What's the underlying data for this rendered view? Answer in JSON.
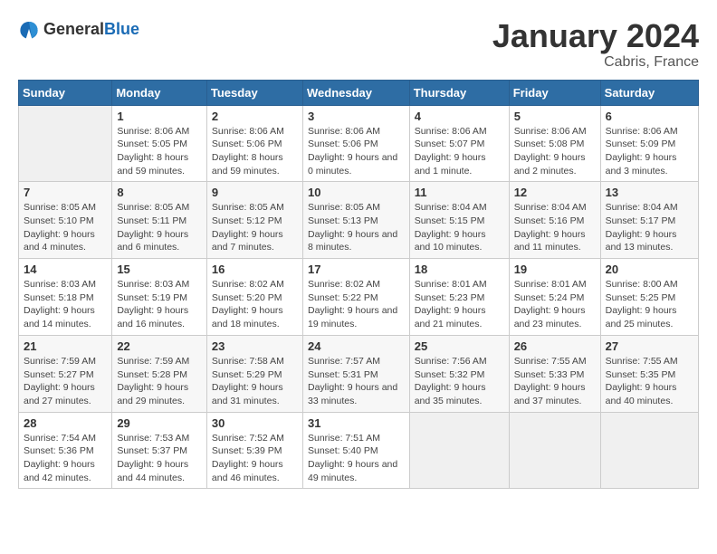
{
  "logo": {
    "text_general": "General",
    "text_blue": "Blue"
  },
  "title": "January 2024",
  "location": "Cabris, France",
  "days_of_week": [
    "Sunday",
    "Monday",
    "Tuesday",
    "Wednesday",
    "Thursday",
    "Friday",
    "Saturday"
  ],
  "weeks": [
    [
      {
        "day": "",
        "sunrise": "",
        "sunset": "",
        "daylight": ""
      },
      {
        "day": "1",
        "sunrise": "Sunrise: 8:06 AM",
        "sunset": "Sunset: 5:05 PM",
        "daylight": "Daylight: 8 hours and 59 minutes."
      },
      {
        "day": "2",
        "sunrise": "Sunrise: 8:06 AM",
        "sunset": "Sunset: 5:06 PM",
        "daylight": "Daylight: 8 hours and 59 minutes."
      },
      {
        "day": "3",
        "sunrise": "Sunrise: 8:06 AM",
        "sunset": "Sunset: 5:06 PM",
        "daylight": "Daylight: 9 hours and 0 minutes."
      },
      {
        "day": "4",
        "sunrise": "Sunrise: 8:06 AM",
        "sunset": "Sunset: 5:07 PM",
        "daylight": "Daylight: 9 hours and 1 minute."
      },
      {
        "day": "5",
        "sunrise": "Sunrise: 8:06 AM",
        "sunset": "Sunset: 5:08 PM",
        "daylight": "Daylight: 9 hours and 2 minutes."
      },
      {
        "day": "6",
        "sunrise": "Sunrise: 8:06 AM",
        "sunset": "Sunset: 5:09 PM",
        "daylight": "Daylight: 9 hours and 3 minutes."
      }
    ],
    [
      {
        "day": "7",
        "sunrise": "Sunrise: 8:05 AM",
        "sunset": "Sunset: 5:10 PM",
        "daylight": "Daylight: 9 hours and 4 minutes."
      },
      {
        "day": "8",
        "sunrise": "Sunrise: 8:05 AM",
        "sunset": "Sunset: 5:11 PM",
        "daylight": "Daylight: 9 hours and 6 minutes."
      },
      {
        "day": "9",
        "sunrise": "Sunrise: 8:05 AM",
        "sunset": "Sunset: 5:12 PM",
        "daylight": "Daylight: 9 hours and 7 minutes."
      },
      {
        "day": "10",
        "sunrise": "Sunrise: 8:05 AM",
        "sunset": "Sunset: 5:13 PM",
        "daylight": "Daylight: 9 hours and 8 minutes."
      },
      {
        "day": "11",
        "sunrise": "Sunrise: 8:04 AM",
        "sunset": "Sunset: 5:15 PM",
        "daylight": "Daylight: 9 hours and 10 minutes."
      },
      {
        "day": "12",
        "sunrise": "Sunrise: 8:04 AM",
        "sunset": "Sunset: 5:16 PM",
        "daylight": "Daylight: 9 hours and 11 minutes."
      },
      {
        "day": "13",
        "sunrise": "Sunrise: 8:04 AM",
        "sunset": "Sunset: 5:17 PM",
        "daylight": "Daylight: 9 hours and 13 minutes."
      }
    ],
    [
      {
        "day": "14",
        "sunrise": "Sunrise: 8:03 AM",
        "sunset": "Sunset: 5:18 PM",
        "daylight": "Daylight: 9 hours and 14 minutes."
      },
      {
        "day": "15",
        "sunrise": "Sunrise: 8:03 AM",
        "sunset": "Sunset: 5:19 PM",
        "daylight": "Daylight: 9 hours and 16 minutes."
      },
      {
        "day": "16",
        "sunrise": "Sunrise: 8:02 AM",
        "sunset": "Sunset: 5:20 PM",
        "daylight": "Daylight: 9 hours and 18 minutes."
      },
      {
        "day": "17",
        "sunrise": "Sunrise: 8:02 AM",
        "sunset": "Sunset: 5:22 PM",
        "daylight": "Daylight: 9 hours and 19 minutes."
      },
      {
        "day": "18",
        "sunrise": "Sunrise: 8:01 AM",
        "sunset": "Sunset: 5:23 PM",
        "daylight": "Daylight: 9 hours and 21 minutes."
      },
      {
        "day": "19",
        "sunrise": "Sunrise: 8:01 AM",
        "sunset": "Sunset: 5:24 PM",
        "daylight": "Daylight: 9 hours and 23 minutes."
      },
      {
        "day": "20",
        "sunrise": "Sunrise: 8:00 AM",
        "sunset": "Sunset: 5:25 PM",
        "daylight": "Daylight: 9 hours and 25 minutes."
      }
    ],
    [
      {
        "day": "21",
        "sunrise": "Sunrise: 7:59 AM",
        "sunset": "Sunset: 5:27 PM",
        "daylight": "Daylight: 9 hours and 27 minutes."
      },
      {
        "day": "22",
        "sunrise": "Sunrise: 7:59 AM",
        "sunset": "Sunset: 5:28 PM",
        "daylight": "Daylight: 9 hours and 29 minutes."
      },
      {
        "day": "23",
        "sunrise": "Sunrise: 7:58 AM",
        "sunset": "Sunset: 5:29 PM",
        "daylight": "Daylight: 9 hours and 31 minutes."
      },
      {
        "day": "24",
        "sunrise": "Sunrise: 7:57 AM",
        "sunset": "Sunset: 5:31 PM",
        "daylight": "Daylight: 9 hours and 33 minutes."
      },
      {
        "day": "25",
        "sunrise": "Sunrise: 7:56 AM",
        "sunset": "Sunset: 5:32 PM",
        "daylight": "Daylight: 9 hours and 35 minutes."
      },
      {
        "day": "26",
        "sunrise": "Sunrise: 7:55 AM",
        "sunset": "Sunset: 5:33 PM",
        "daylight": "Daylight: 9 hours and 37 minutes."
      },
      {
        "day": "27",
        "sunrise": "Sunrise: 7:55 AM",
        "sunset": "Sunset: 5:35 PM",
        "daylight": "Daylight: 9 hours and 40 minutes."
      }
    ],
    [
      {
        "day": "28",
        "sunrise": "Sunrise: 7:54 AM",
        "sunset": "Sunset: 5:36 PM",
        "daylight": "Daylight: 9 hours and 42 minutes."
      },
      {
        "day": "29",
        "sunrise": "Sunrise: 7:53 AM",
        "sunset": "Sunset: 5:37 PM",
        "daylight": "Daylight: 9 hours and 44 minutes."
      },
      {
        "day": "30",
        "sunrise": "Sunrise: 7:52 AM",
        "sunset": "Sunset: 5:39 PM",
        "daylight": "Daylight: 9 hours and 46 minutes."
      },
      {
        "day": "31",
        "sunrise": "Sunrise: 7:51 AM",
        "sunset": "Sunset: 5:40 PM",
        "daylight": "Daylight: 9 hours and 49 minutes."
      },
      {
        "day": "",
        "sunrise": "",
        "sunset": "",
        "daylight": ""
      },
      {
        "day": "",
        "sunrise": "",
        "sunset": "",
        "daylight": ""
      },
      {
        "day": "",
        "sunrise": "",
        "sunset": "",
        "daylight": ""
      }
    ]
  ]
}
